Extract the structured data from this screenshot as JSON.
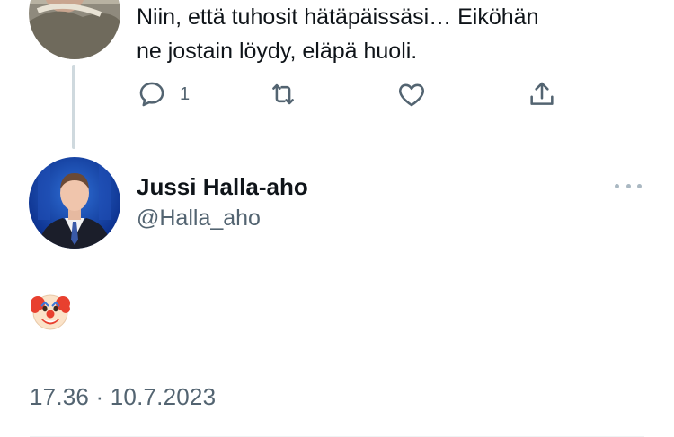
{
  "reply": {
    "text_line1": "Niin, että tuhosit hätäpäissäsi… Eiköhän",
    "text_line2": "ne jostain löydy, eläpä huoli.",
    "reply_count": "1"
  },
  "tweet": {
    "name": "Jussi Halla-aho",
    "handle": "@Halla_aho",
    "content_emoji": "clown-face",
    "timestamp": "17.36 · 10.7.2023"
  },
  "icons": {
    "reply": "speech-bubble-icon",
    "retweet": "retweet-icon",
    "like": "heart-icon",
    "share": "share-icon",
    "more": "ellipsis-icon"
  },
  "colors": {
    "text": "#0f1419",
    "secondary": "#536471",
    "thread_line": "#cfd9de"
  }
}
